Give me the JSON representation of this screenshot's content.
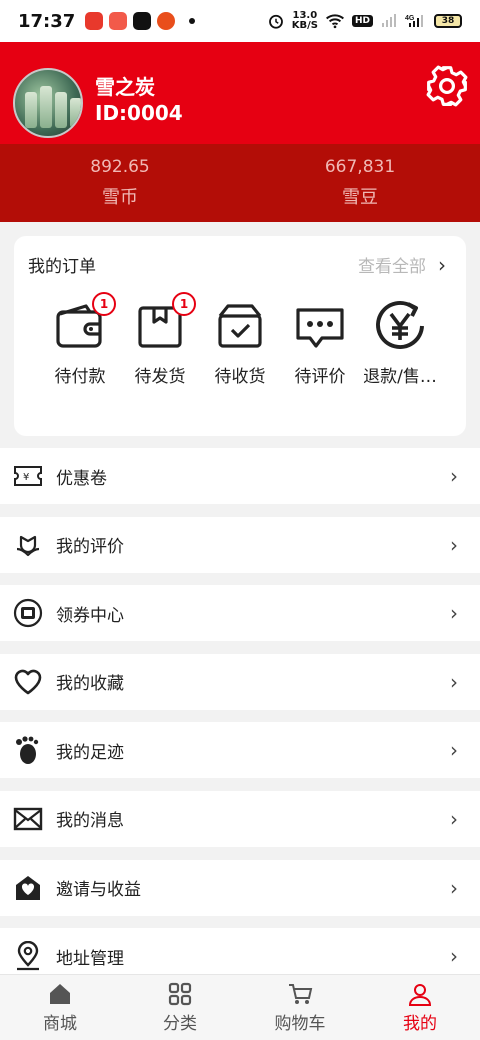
{
  "status_bar": {
    "time": "17:37",
    "net_speed_value": "13.0",
    "net_speed_unit": "KB/S",
    "hd_label": "HD",
    "network_label": "4G",
    "battery": "38"
  },
  "profile": {
    "name": "雪之炭",
    "id": "ID:0004"
  },
  "wallet": [
    {
      "value": "892.65",
      "label": "雪币"
    },
    {
      "value": "667,831",
      "label": "雪豆"
    }
  ],
  "orders": {
    "title": "我的订单",
    "view_all": "查看全部",
    "items": [
      {
        "label": "待付款",
        "badge": "1",
        "icon": "wallet-icon"
      },
      {
        "label": "待发货",
        "badge": "1",
        "icon": "package-icon"
      },
      {
        "label": "待收货",
        "badge": "",
        "icon": "box-check-icon"
      },
      {
        "label": "待评价",
        "badge": "",
        "icon": "chat-icon"
      },
      {
        "label": "退款/售…",
        "badge": "",
        "icon": "refund-yen-icon"
      }
    ]
  },
  "menu": [
    {
      "label": "优惠卷",
      "icon": "coupon-icon"
    },
    {
      "label": "我的评价",
      "icon": "review-flower-icon"
    },
    {
      "label": "领券中心",
      "icon": "coupon-center-icon"
    },
    {
      "label": "我的收藏",
      "icon": "heart-icon"
    },
    {
      "label": "我的足迹",
      "icon": "footprint-icon"
    },
    {
      "label": "我的消息",
      "icon": "mail-icon"
    },
    {
      "label": "邀请与收益",
      "icon": "invite-heart-icon"
    },
    {
      "label": "地址管理",
      "icon": "location-pin-icon"
    }
  ],
  "tabs": [
    {
      "label": "商城",
      "icon": "home-icon",
      "active": false
    },
    {
      "label": "分类",
      "icon": "grid-icon",
      "active": false
    },
    {
      "label": "购物车",
      "icon": "cart-icon",
      "active": false
    },
    {
      "label": "我的",
      "icon": "user-icon",
      "active": true
    }
  ],
  "colors": {
    "brand_red": "#e60012",
    "wallet_band": "#b30d07",
    "wallet_text": "#f0b8b4"
  }
}
